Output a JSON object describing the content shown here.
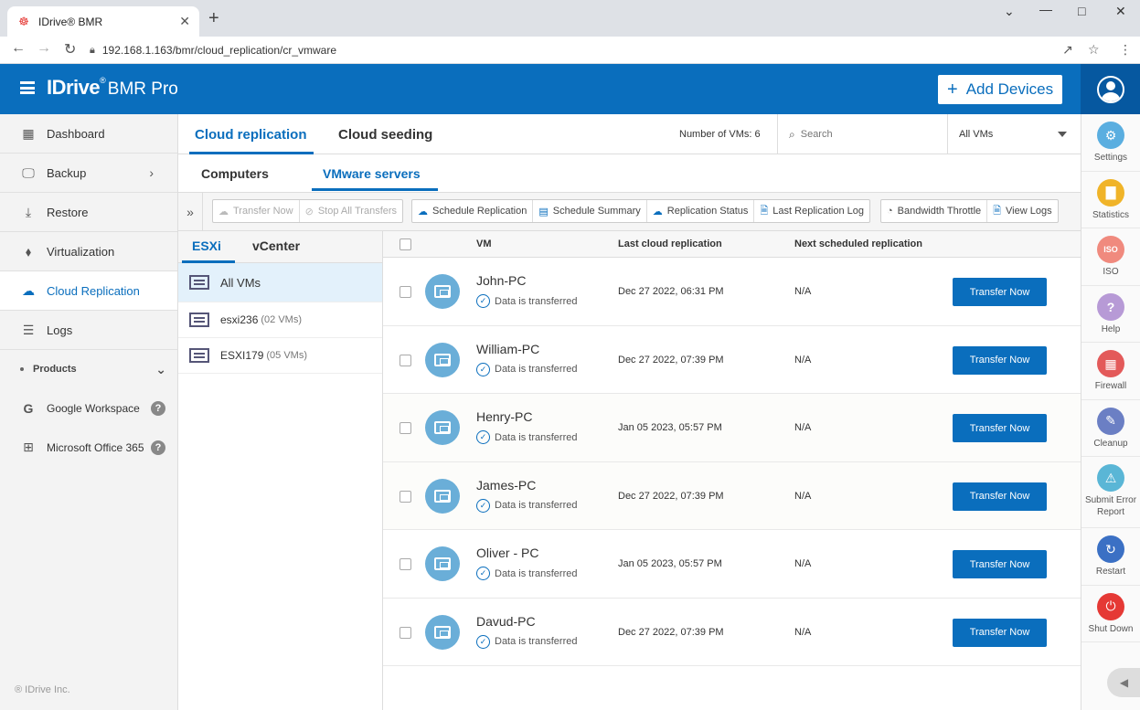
{
  "browser": {
    "tab_title": "IDrive® BMR",
    "url": "192.168.1.163/bmr/cloud_replication/cr_vmware"
  },
  "header": {
    "logo_brand": "IDrive",
    "logo_sup": "®",
    "logo_sub": "BMR Pro",
    "add_devices": "Add Devices",
    "accent_color": "#0a6ebd"
  },
  "sidebar": {
    "items": [
      {
        "label": "Dashboard",
        "icon": "dashboard-icon"
      },
      {
        "label": "Backup",
        "icon": "backup-icon"
      },
      {
        "label": "Restore",
        "icon": "restore-icon"
      },
      {
        "label": "Virtualization",
        "icon": "layers-icon"
      },
      {
        "label": "Cloud Replication",
        "icon": "cloud-icon"
      },
      {
        "label": "Logs",
        "icon": "logs-icon"
      }
    ],
    "products_label": "Products",
    "products": [
      {
        "label": "Google Workspace",
        "icon": "google-icon"
      },
      {
        "label": "Microsoft Office 365",
        "icon": "windows-icon"
      }
    ],
    "copyright": "® IDrive Inc."
  },
  "rightbar": {
    "items": [
      {
        "label": "Settings",
        "color": "#5aaee0",
        "icon": "gear-icon"
      },
      {
        "label": "Statistics",
        "color": "#f0b429",
        "icon": "chart-icon"
      },
      {
        "label": "ISO",
        "color": "#f08a7e",
        "icon": "iso-icon"
      },
      {
        "label": "Help",
        "color": "#b79ad6",
        "icon": "help-icon"
      },
      {
        "label": "Firewall",
        "color": "#e35a5a",
        "icon": "firewall-icon"
      },
      {
        "label": "Cleanup",
        "color": "#6b7fc4",
        "icon": "cleanup-icon"
      },
      {
        "label": "Submit Error Report",
        "color": "#5ab6d6",
        "icon": "warning-icon"
      },
      {
        "label": "Restart",
        "color": "#3b70c4",
        "icon": "restart-icon"
      },
      {
        "label": "Shut Down",
        "color": "#e53935",
        "icon": "power-icon"
      }
    ]
  },
  "main": {
    "tabs": [
      "Cloud replication",
      "Cloud seeding"
    ],
    "num_vms": "Number of VMs: 6",
    "search_placeholder": "Search",
    "vm_filter": "All VMs",
    "sub_tabs": [
      "Computers",
      "VMware servers"
    ],
    "toolbar": {
      "transfer_now": "Transfer Now",
      "stop_all": "Stop All Transfers",
      "schedule_replication": "Schedule Replication",
      "schedule_summary": "Schedule Summary",
      "replication_status": "Replication Status",
      "last_log": "Last Replication Log",
      "bandwidth": "Bandwidth Throttle",
      "view_logs": "View Logs"
    },
    "server_tabs": [
      "ESXi",
      "vCenter"
    ],
    "servers": [
      {
        "name": "All VMs",
        "count": ""
      },
      {
        "name": "esxi236",
        "count": "(02 VMs)"
      },
      {
        "name": "ESXI179",
        "count": "(05 VMs)"
      }
    ],
    "table": {
      "headers": {
        "vm": "VM",
        "last": "Last cloud replication",
        "next": "Next scheduled replication"
      },
      "rows": [
        {
          "name": "John-PC",
          "status": "Data is transferred",
          "last": "Dec 27 2022, 06:31 PM",
          "next": "N/A",
          "action": "Transfer Now"
        },
        {
          "name": "William-PC",
          "status": "Data is transferred",
          "last": "Dec 27 2022, 07:39 PM",
          "next": "N/A",
          "action": "Transfer Now"
        },
        {
          "name": "Henry-PC",
          "status": "Data is transferred",
          "last": "Jan 05 2023, 05:57 PM",
          "next": "N/A",
          "action": "Transfer Now"
        },
        {
          "name": "James-PC",
          "status": "Data is transferred",
          "last": "Dec 27 2022, 07:39 PM",
          "next": "N/A",
          "action": "Transfer Now"
        },
        {
          "name": "Oliver - PC",
          "status": "Data is transferred",
          "last": "Jan 05 2023, 05:57 PM",
          "next": "N/A",
          "action": "Transfer Now"
        },
        {
          "name": "Davud-PC",
          "status": "Data is transferred",
          "last": "Dec 27 2022, 07:39 PM",
          "next": "N/A",
          "action": "Transfer Now"
        }
      ]
    }
  }
}
